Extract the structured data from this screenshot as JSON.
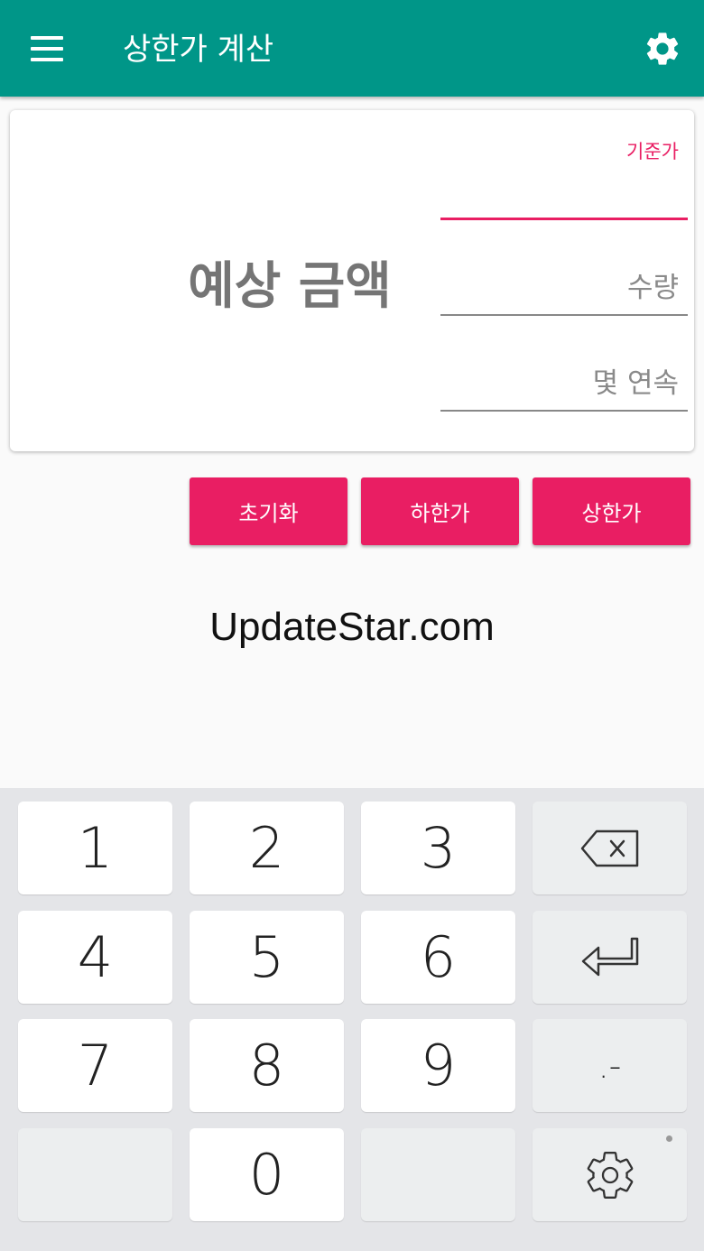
{
  "app_bar": {
    "title": "상한가 계산",
    "menu_icon": "hamburger-menu-icon",
    "settings_icon": "gear-icon",
    "color": "#009688"
  },
  "card": {
    "estimate_label": "예상 금액",
    "fields": [
      {
        "label": "기준가",
        "value": "",
        "placeholder": ""
      },
      {
        "label": "",
        "value": "",
        "placeholder": "수량"
      },
      {
        "label": "",
        "value": "",
        "placeholder": "몇 연속"
      }
    ]
  },
  "actions": {
    "reset_label": "초기화",
    "lower_limit_label": "하한가",
    "upper_limit_label": "상한가",
    "color": "#e91e63"
  },
  "watermark": "UpdateStar.com",
  "keyboard": {
    "digits": [
      "1",
      "2",
      "3",
      "4",
      "5",
      "6",
      "7",
      "8",
      "9",
      "0"
    ],
    "punct_label": ".-",
    "backspace_icon": "backspace-icon",
    "enter_icon": "enter-icon",
    "settings_icon": "keyboard-settings-icon"
  }
}
